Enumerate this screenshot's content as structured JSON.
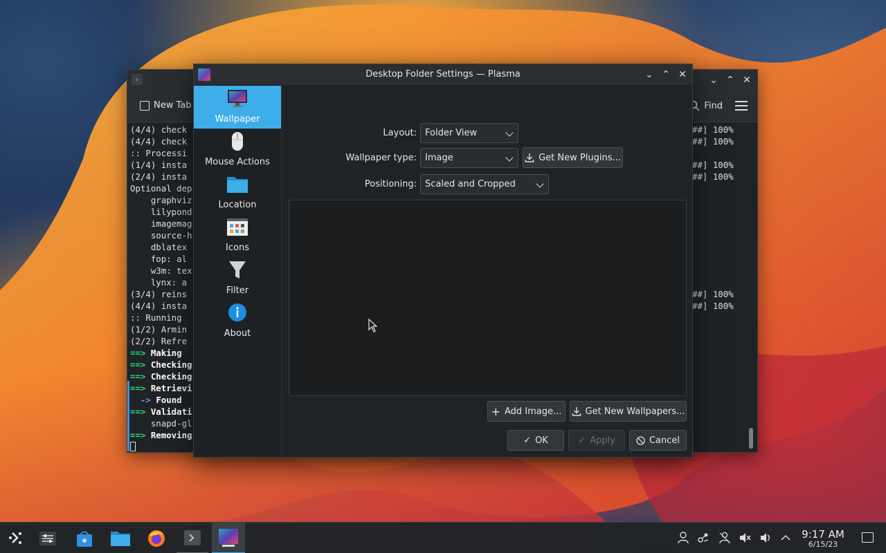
{
  "terminal": {
    "toolbar": {
      "new_tab_label": "New Tab",
      "find_label": "Find"
    },
    "lines": [
      "(4/4) check",
      "(4/4) check",
      ":: Processi",
      "(1/4) insta",
      "(2/4) insta",
      "Optional dep",
      "    graphviz",
      "    lilypond",
      "    imagemag",
      "    source-h",
      "    dblatex",
      "    fop: al",
      "    w3m: tex",
      "    lynx: a",
      "(3/4) reins",
      "(4/4) insta",
      ":: Running ",
      "(1/2) Armin",
      "(2/2) Refre"
    ],
    "arrow_lines": [
      {
        "arrow": "==> ",
        "text": "Making ",
        "color": "green"
      },
      {
        "arrow": "==> ",
        "text": "Checking",
        "color": "green"
      },
      {
        "arrow": "==> ",
        "text": "Checking",
        "color": "green"
      },
      {
        "arrow": "==> ",
        "text": "Retrievi",
        "color": "green"
      },
      {
        "arrow": "  -> ",
        "text": "Found ",
        "color": "blue"
      },
      {
        "arrow": "==> ",
        "text": "Validati",
        "color": "green"
      },
      {
        "arrow": "    ",
        "text": "snapd-gl",
        "color": "plain"
      },
      {
        "arrow": "==> ",
        "text": "Removing",
        "color": "green"
      }
    ],
    "right_lines": [
      "##] 100%",
      "##] 100%",
      "",
      "##] 100%",
      "##] 100%",
      "",
      "",
      "",
      "",
      "",
      "",
      "",
      "",
      "",
      "##] 100%",
      "##] 100%"
    ]
  },
  "dialog": {
    "title": "Desktop Folder Settings — Plasma",
    "sidebar": [
      {
        "label": "Wallpaper",
        "icon": "monitor-icon",
        "active": true
      },
      {
        "label": "Mouse Actions",
        "icon": "mouse-icon",
        "active": false
      },
      {
        "label": "Location",
        "icon": "folder-icon",
        "active": false
      },
      {
        "label": "Icons",
        "icon": "icons-grid-icon",
        "active": false
      },
      {
        "label": "Filter",
        "icon": "filter-icon",
        "active": false
      },
      {
        "label": "About",
        "icon": "info-icon",
        "active": false
      }
    ],
    "form": {
      "layout_label": "Layout:",
      "layout_value": "Folder View",
      "wallpaper_type_label": "Wallpaper type:",
      "wallpaper_type_value": "Image",
      "get_new_plugins": "Get New Plugins...",
      "positioning_label": "Positioning:",
      "positioning_value": "Scaled and Cropped"
    },
    "buttons": {
      "add_image": "Add Image...",
      "get_new_wallpapers": "Get New Wallpapers...",
      "ok": "OK",
      "apply": "Apply",
      "cancel": "Cancel"
    }
  },
  "taskbar": {
    "clock_time": "9:17 AM",
    "clock_date": "6/15/23",
    "launchers": [
      "application-launcher-icon",
      "system-settings-icon",
      "discover-store-icon",
      "dolphin-folder-icon",
      "firefox-icon",
      "konsole-terminal-icon",
      "plasma-settings-icon"
    ],
    "tray": [
      "user-icon",
      "kde-connect-icon",
      "accounts-icon",
      "muted-speaker-icon",
      "volume-icon",
      "expand-tray-icon"
    ]
  },
  "colors": {
    "accent": "#3daee9",
    "window_bg": "#202326",
    "terminal_green": "#2bd67b"
  }
}
